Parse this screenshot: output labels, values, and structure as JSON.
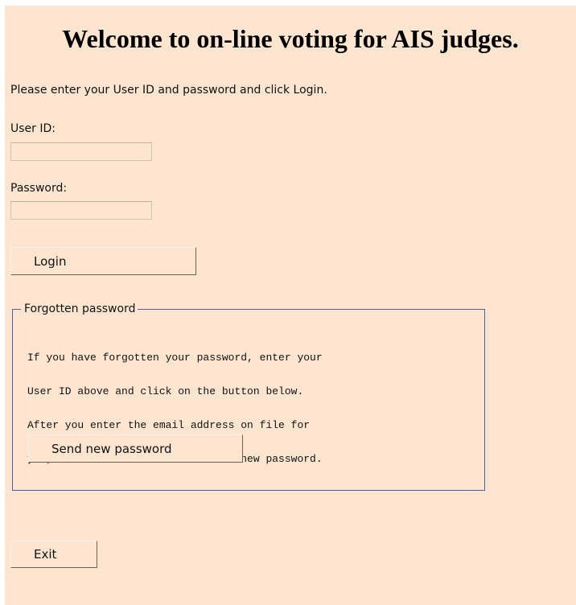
{
  "page": {
    "title": "Welcome to on-line voting for AIS judges.",
    "instructions": "Please enter your User ID and password and click Login."
  },
  "login_form": {
    "user_id_label": "User ID:",
    "user_id_value": "",
    "password_label": "Password:",
    "password_value": "",
    "login_button": "Login"
  },
  "forgotten_password": {
    "legend": "Forgotten password",
    "note_lines": [
      "If you have forgotten your password, enter your",
      "User ID above and click on the button below.",
      "After you enter the email address on file for",
      "you, an email will be sent with a new password."
    ],
    "send_button": "Send new password"
  },
  "footer": {
    "exit_button": "Exit"
  },
  "colors": {
    "background": "#fee5d0",
    "fieldset_border": "#4a5fb5"
  }
}
